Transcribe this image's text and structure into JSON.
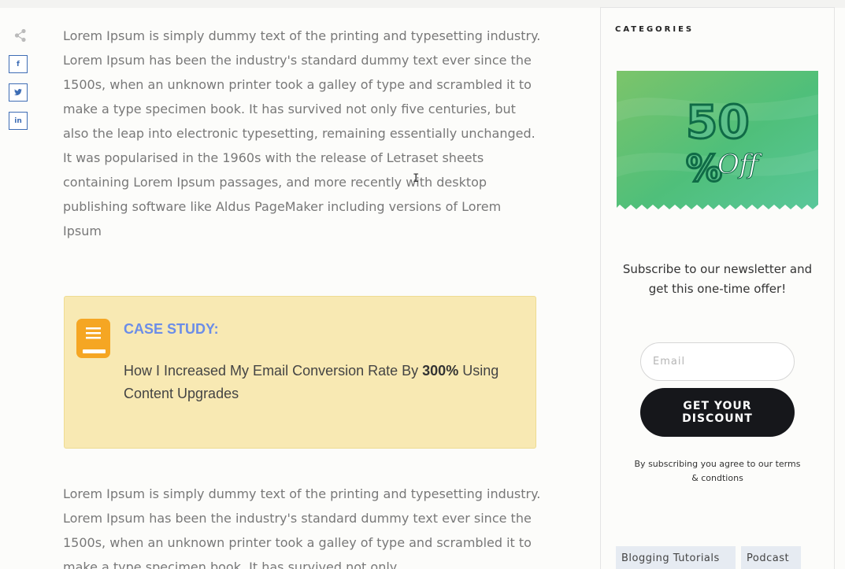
{
  "share": {
    "social": [
      {
        "name": "facebook",
        "glyph": "f"
      },
      {
        "name": "twitter",
        "glyph": "t"
      },
      {
        "name": "linkedin",
        "glyph": "in"
      }
    ]
  },
  "article": {
    "paragraph1": "Lorem Ipsum is simply dummy text of the printing and typesetting industry. Lorem Ipsum has been the industry's standard dummy text ever since the 1500s, when an unknown printer took a galley of type and scrambled it to make a type specimen book. It has survived not only five centuries, but also the leap into electronic typesetting, remaining essentially unchanged. It was popularised in the 1960s with the release of Letraset sheets containing Lorem Ipsum passages, and more recently with desktop publishing software like Aldus PageMaker including versions of Lorem Ipsum",
    "paragraph2": "Lorem Ipsum is simply dummy text of the printing and typesetting industry. Lorem Ipsum has been the industry's standard dummy text ever since the 1500s, when an unknown printer took a galley of type and scrambled it to make a type specimen book. It has survived not only"
  },
  "case_study": {
    "title": "CASE STUDY:",
    "text_before": "How I Increased My Email Conversion Rate By ",
    "highlight": "300%",
    "text_after": " Using Content Upgrades"
  },
  "sidebar": {
    "categories_title": "CATEGORIES",
    "promo": {
      "big": "50",
      "small": "%",
      "script": "Off"
    },
    "subscribe_text": "Subscribe to our newsletter and get this one-time offer!",
    "email_placeholder": "Email",
    "cta_line1": "GET YOUR",
    "cta_line2": "DISCOUNT",
    "terms": "By subscribing you agree to our terms & condtions",
    "tags": [
      "Blogging Tutorials",
      "Podcast"
    ]
  },
  "colors": {
    "social_blue": "#3e6db5",
    "callout_bg": "#f8e9b3",
    "callout_title": "#6b8de8",
    "cta_bg": "#16171b",
    "tag_bg": "#e6ebf2"
  }
}
